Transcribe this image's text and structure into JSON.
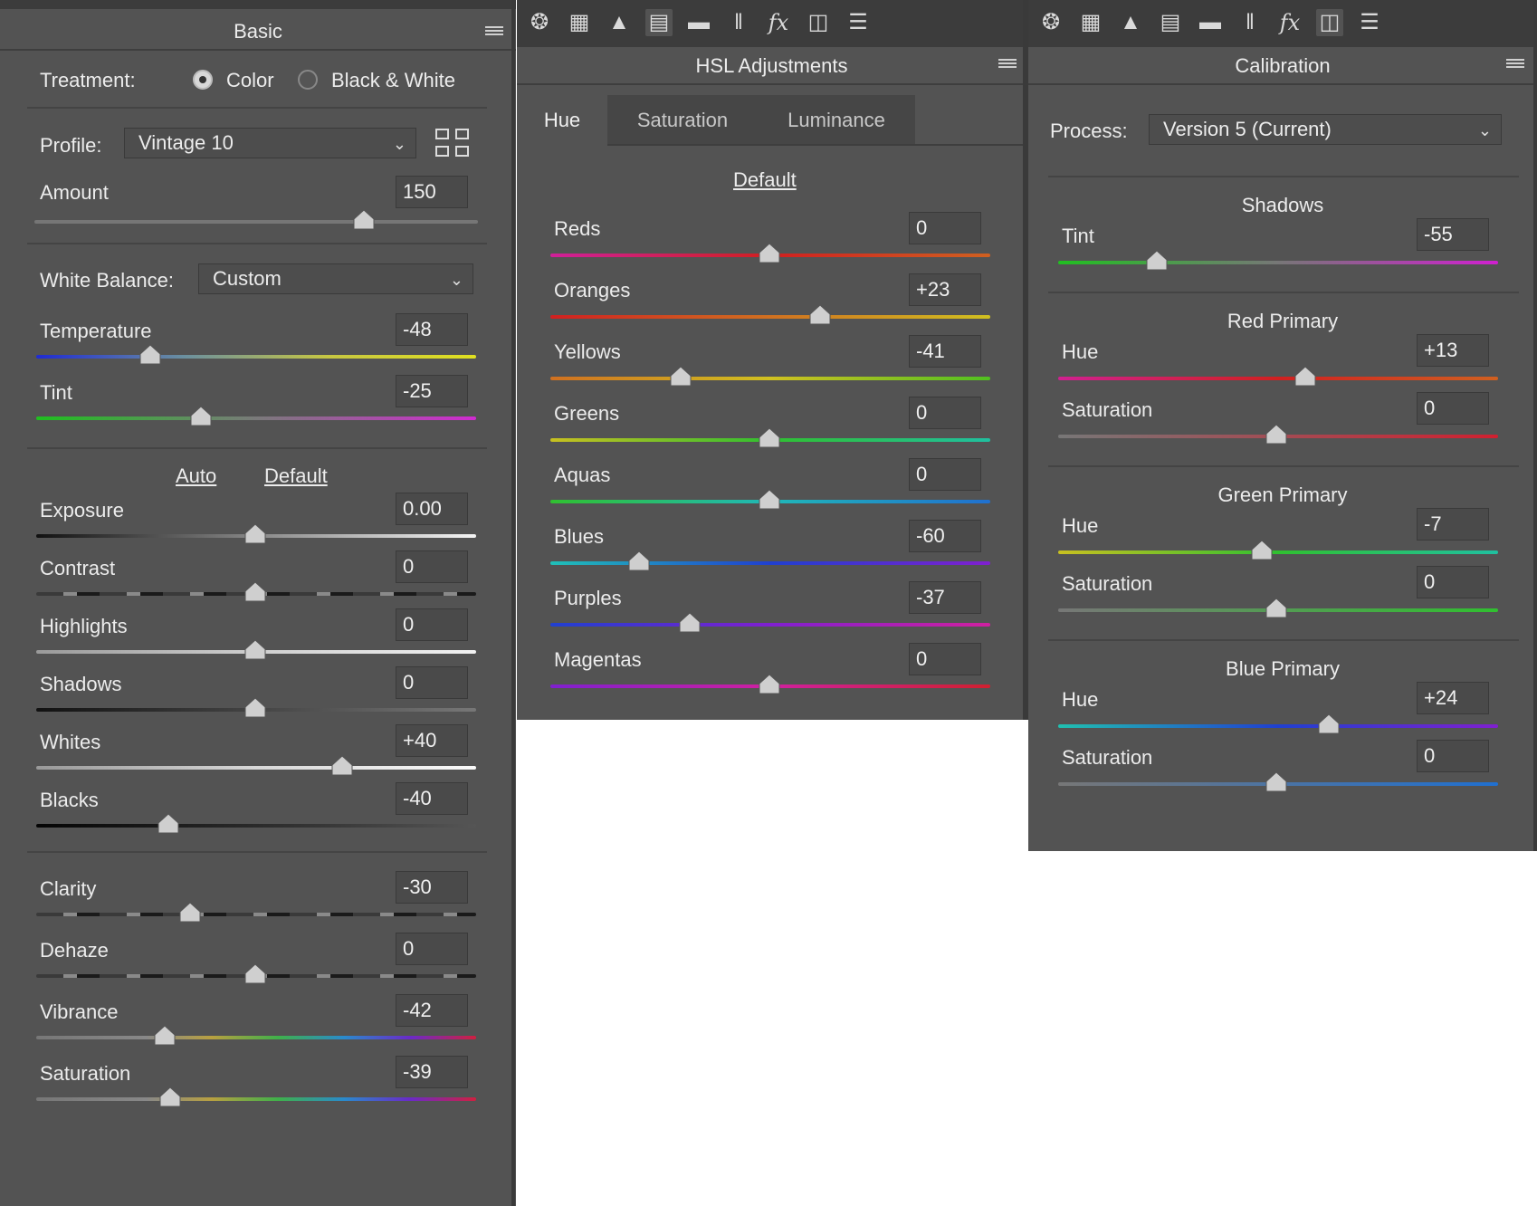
{
  "basic": {
    "title": "Basic",
    "treatment_label": "Treatment:",
    "treatment_options": [
      "Color",
      "Black & White"
    ],
    "treatment_selected": "Color",
    "profile_label": "Profile:",
    "profile_value": "Vintage 10",
    "amount_label": "Amount",
    "amount_value": "150",
    "wb_label": "White Balance:",
    "wb_value": "Custom",
    "temperature": {
      "label": "Temperature",
      "value": "-48"
    },
    "tint": {
      "label": "Tint",
      "value": "-25"
    },
    "auto_label": "Auto",
    "default_label": "Default",
    "sliders": [
      {
        "label": "Exposure",
        "value": "0.00"
      },
      {
        "label": "Contrast",
        "value": "0"
      },
      {
        "label": "Highlights",
        "value": "0"
      },
      {
        "label": "Shadows",
        "value": "0"
      },
      {
        "label": "Whites",
        "value": "+40"
      },
      {
        "label": "Blacks",
        "value": "-40"
      }
    ],
    "presence": [
      {
        "label": "Clarity",
        "value": "-30"
      },
      {
        "label": "Dehaze",
        "value": "0"
      },
      {
        "label": "Vibrance",
        "value": "-42"
      },
      {
        "label": "Saturation",
        "value": "-39"
      }
    ]
  },
  "hsl": {
    "title": "HSL Adjustments",
    "tabs": [
      "Hue",
      "Saturation",
      "Luminance"
    ],
    "active_tab": "Hue",
    "default_label": "Default",
    "sliders": [
      {
        "label": "Reds",
        "value": "0"
      },
      {
        "label": "Oranges",
        "value": "+23"
      },
      {
        "label": "Yellows",
        "value": "-41"
      },
      {
        "label": "Greens",
        "value": "0"
      },
      {
        "label": "Aquas",
        "value": "0"
      },
      {
        "label": "Blues",
        "value": "-60"
      },
      {
        "label": "Purples",
        "value": "-37"
      },
      {
        "label": "Magentas",
        "value": "0"
      }
    ]
  },
  "calibration": {
    "title": "Calibration",
    "process_label": "Process:",
    "process_value": "Version 5 (Current)",
    "shadows": {
      "title": "Shadows",
      "tint_label": "Tint",
      "tint_value": "-55"
    },
    "red_primary": {
      "title": "Red Primary",
      "hue_label": "Hue",
      "hue_value": "+13",
      "sat_label": "Saturation",
      "sat_value": "0"
    },
    "green_primary": {
      "title": "Green Primary",
      "hue_label": "Hue",
      "hue_value": "-7",
      "sat_label": "Saturation",
      "sat_value": "0"
    },
    "blue_primary": {
      "title": "Blue Primary",
      "hue_label": "Hue",
      "hue_value": "+24",
      "sat_label": "Saturation",
      "sat_value": "0"
    }
  },
  "toolbar_icons": [
    "aperture-icon",
    "grid-icon",
    "mountains-icon",
    "split-horizontal-icon",
    "split-bars-icon",
    "lens-icon",
    "fx-icon",
    "filmstrip-icon",
    "sliders-icon"
  ]
}
